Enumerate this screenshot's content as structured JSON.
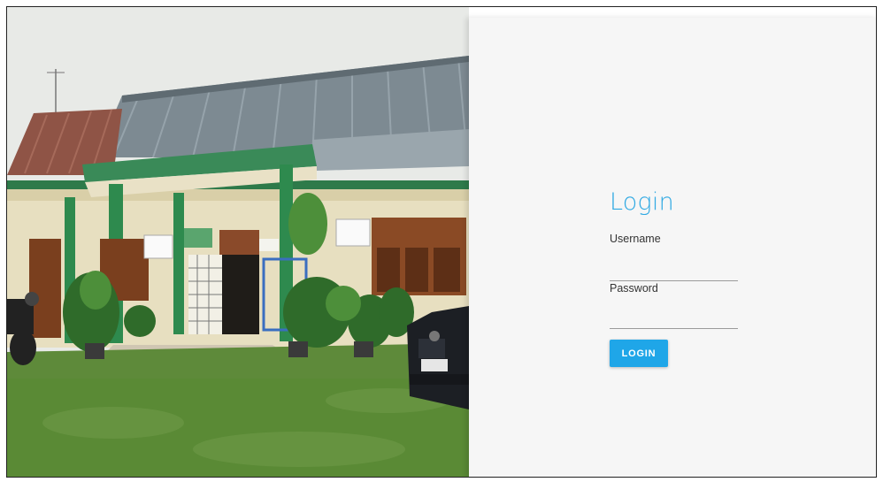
{
  "login": {
    "title": "Login",
    "username_label": "Username",
    "username_value": "",
    "password_label": "Password",
    "password_value": "",
    "button_label": "LOGIN"
  },
  "colors": {
    "accent": "#2fa9e3",
    "button": "#1fa6e8",
    "panel_bg": "#f6f6f6"
  },
  "photo": {
    "subject": "building-photo"
  }
}
